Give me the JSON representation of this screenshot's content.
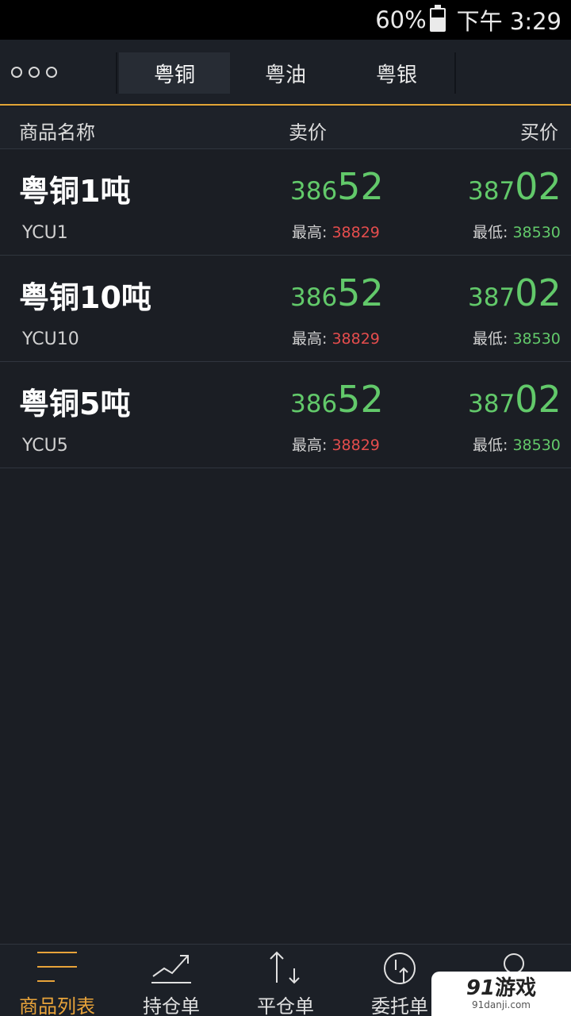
{
  "status_bar": {
    "battery": "60%",
    "time": "下午 3:29"
  },
  "top_nav": {
    "tabs": [
      {
        "label": "粤铜",
        "active": true
      },
      {
        "label": "粤油",
        "active": false
      },
      {
        "label": "粤银",
        "active": false
      }
    ]
  },
  "columns": {
    "name": "商品名称",
    "sell": "卖价",
    "buy": "买价"
  },
  "products": [
    {
      "name": "粤铜1吨",
      "code": "YCU1",
      "sell_small": "386",
      "sell_big": "52",
      "buy_small": "387",
      "buy_big": "02",
      "high_label": "最高:",
      "high": "38829",
      "low_label": "最低:",
      "low": "38530"
    },
    {
      "name": "粤铜10吨",
      "code": "YCU10",
      "sell_small": "386",
      "sell_big": "52",
      "buy_small": "387",
      "buy_big": "02",
      "high_label": "最高:",
      "high": "38829",
      "low_label": "最低:",
      "low": "38530"
    },
    {
      "name": "粤铜5吨",
      "code": "YCU5",
      "sell_small": "386",
      "sell_big": "52",
      "buy_small": "387",
      "buy_big": "02",
      "high_label": "最高:",
      "high": "38829",
      "low_label": "最低:",
      "low": "38530"
    }
  ],
  "bottom_nav": [
    {
      "label": "商品列表",
      "icon": "list-icon",
      "active": true
    },
    {
      "label": "持仓单",
      "icon": "trend-up-icon",
      "active": false
    },
    {
      "label": "平仓单",
      "icon": "arrows-up-down-icon",
      "active": false
    },
    {
      "label": "委托单",
      "icon": "clock-upload-icon",
      "active": false
    },
    {
      "label": "",
      "icon": "user-icon",
      "active": false
    }
  ],
  "watermark": {
    "brand_num": "91",
    "brand_text": "游戏",
    "url": "91danji.com"
  },
  "colors": {
    "accent": "#e8a33a",
    "price_green": "#62c96a",
    "price_red": "#e54d4d",
    "background": "#1b1e24"
  }
}
